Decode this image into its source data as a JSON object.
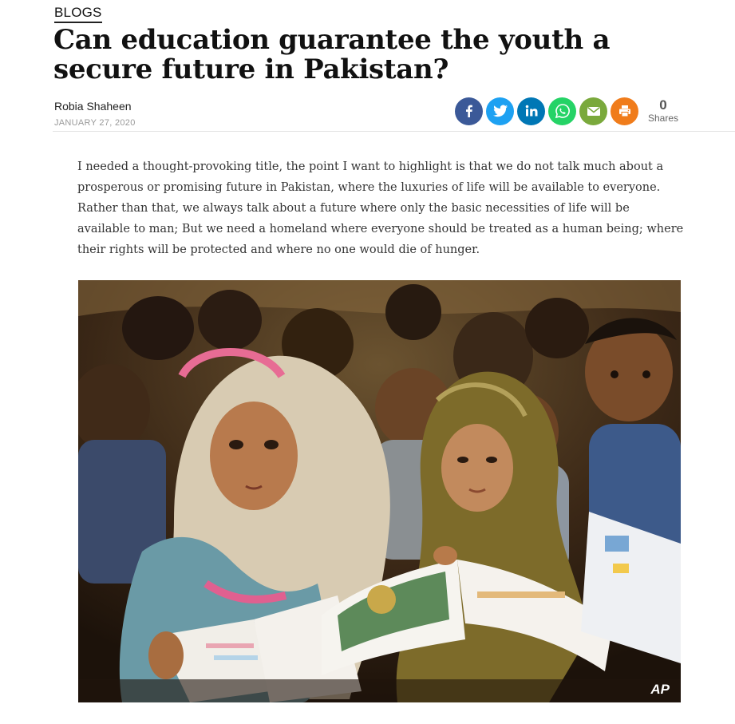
{
  "article": {
    "category": "BLOGS",
    "title": "Can education guarantee the youth a secure future in Pakistan?",
    "author": "Robia Shaheen",
    "date": "JANUARY 27, 2020",
    "body": "I needed a thought-provoking title, the point I want to highlight is that we do not talk much about a prosperous or promising future in Pakistan, where the luxuries of life will be available to everyone. Rather than that, we always talk about a future where only the basic necessities of life will be available to man; But we need a homeland where everyone should be treated as a human being; where their rights will be protected and where no one would die of hunger.",
    "photo_credit": "AP"
  },
  "share": {
    "count": "0",
    "label": "Shares",
    "buttons": [
      {
        "icon": "facebook-icon",
        "color": "#3b5998"
      },
      {
        "icon": "twitter-icon",
        "color": "#1da1f2"
      },
      {
        "icon": "linkedin-icon",
        "color": "#0077b5"
      },
      {
        "icon": "whatsapp-icon",
        "color": "#25d366"
      },
      {
        "icon": "email-icon",
        "color": "#7aa93c"
      },
      {
        "icon": "print-icon",
        "color": "#f07c1b"
      }
    ]
  }
}
